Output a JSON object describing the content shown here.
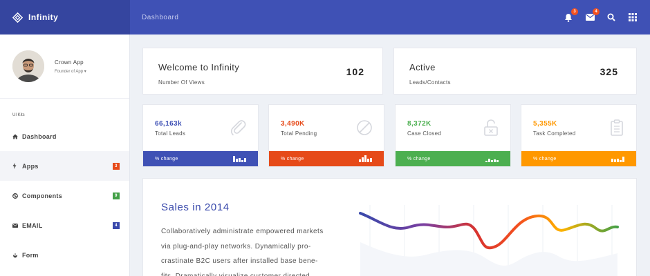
{
  "topbar": {
    "brand": "Infinity",
    "breadcrumb": "Dashboard",
    "notifications_count": "3",
    "messages_count": "4",
    "colors": {
      "bar": "#3f51b5",
      "brand_bg": "#35459f",
      "badge": "#f4511e"
    }
  },
  "sidebar": {
    "profile": {
      "name": "Crown App",
      "role": "Founder of App"
    },
    "section_label": "UI Kits",
    "items": [
      {
        "label": "Dashboard",
        "icon": "home-icon",
        "badge": ""
      },
      {
        "label": "Apps",
        "icon": "bolt-icon",
        "badge": "3",
        "badge_color": "#e64a19"
      },
      {
        "label": "Components",
        "icon": "dribbble-icon",
        "badge": "9",
        "badge_color": "#43a047"
      },
      {
        "label": "EMAIL",
        "icon": "envelope-icon",
        "badge": "4",
        "badge_color": "#3949ab"
      },
      {
        "label": "Form",
        "icon": "rebel-icon",
        "badge": ""
      }
    ]
  },
  "welcome": {
    "left": {
      "title": "Welcome to Infinity",
      "subtitle": "Number Of Views",
      "value": "102"
    },
    "right": {
      "title": "Active",
      "subtitle": "Leads/Contacts",
      "value": "325"
    }
  },
  "stats": [
    {
      "value": "66,163k",
      "label": "Total Leads",
      "change": "% change",
      "color": "#3f51b5",
      "icon": "paperclip-icon"
    },
    {
      "value": "3,490K",
      "label": "Total Pending",
      "change": "% change",
      "color": "#e64a19",
      "icon": "ban-icon"
    },
    {
      "value": "8,372K",
      "label": "Case Closed",
      "change": "% change",
      "color": "#4caf50",
      "icon": "unlock-icon"
    },
    {
      "value": "5,355K",
      "label": "Task Completed",
      "change": "% change",
      "color": "#ff9800",
      "icon": "clipboard-icon"
    }
  ],
  "sales": {
    "title": "Sales in 2014",
    "lines": [
      "Collaboratively administrate empowered markets",
      "via plug-and-play networks. Dynamically pro-",
      "crastinate B2C users after installed base bene-",
      "fits. Dramatically visualize customer directed"
    ]
  }
}
